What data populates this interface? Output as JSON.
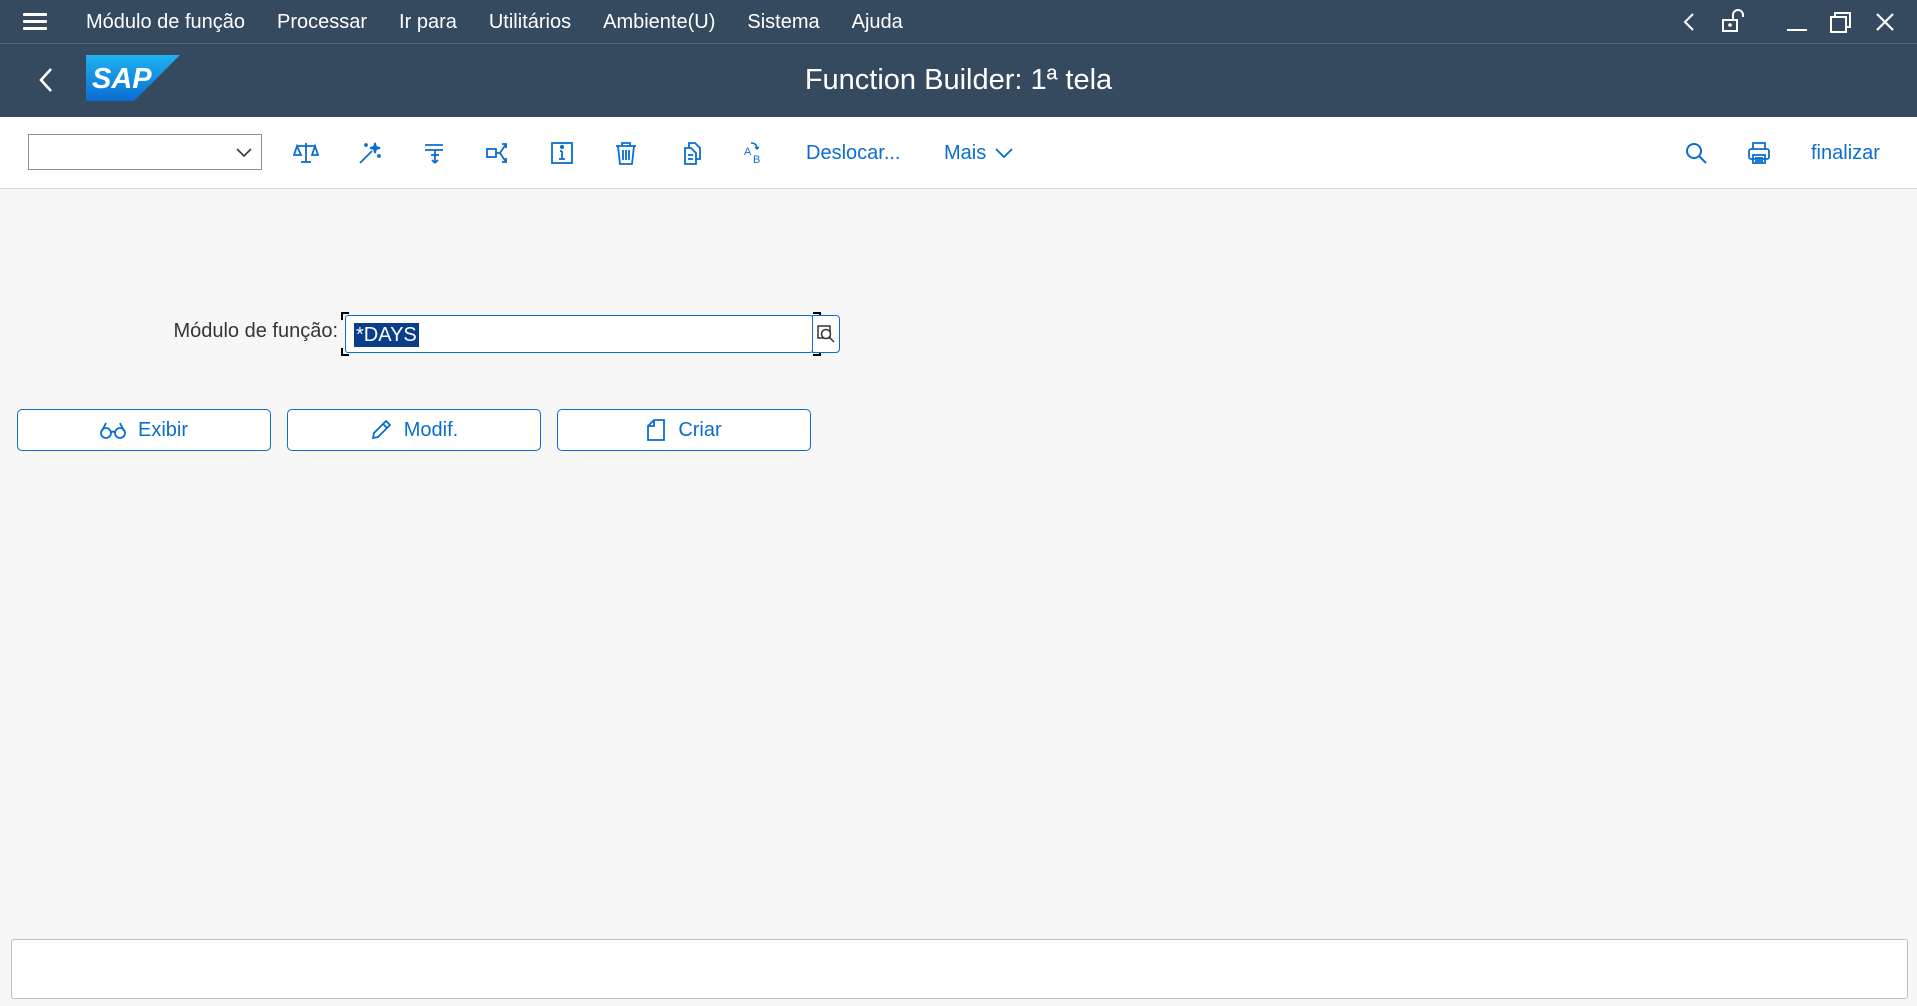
{
  "menubar": {
    "items": [
      "Módulo de função",
      "Processar",
      "Ir para",
      "Utilitários",
      "Ambiente(U)",
      "Sistema",
      "Ajuda"
    ]
  },
  "shell": {
    "logo_text": "SAP",
    "title": "Function Builder: 1ª tela"
  },
  "toolbar": {
    "dropdown_value": "",
    "icons": [
      "balance-scale-icon",
      "magic-wand-icon",
      "where-used-icon",
      "redirect-icon",
      "info-icon",
      "delete-icon",
      "copy-icon",
      "rename-icon"
    ],
    "move_label": "Deslocar...",
    "more_label": "Mais",
    "finish_label": "finalizar"
  },
  "form": {
    "label": "Módulo de função:",
    "value": "*DAYS"
  },
  "buttons": {
    "display": "Exibir",
    "change": "Modif.",
    "create": "Criar"
  },
  "colors": {
    "shell": "#354a5f",
    "accent": "#0a6ed1",
    "background": "#f7f7f7"
  }
}
